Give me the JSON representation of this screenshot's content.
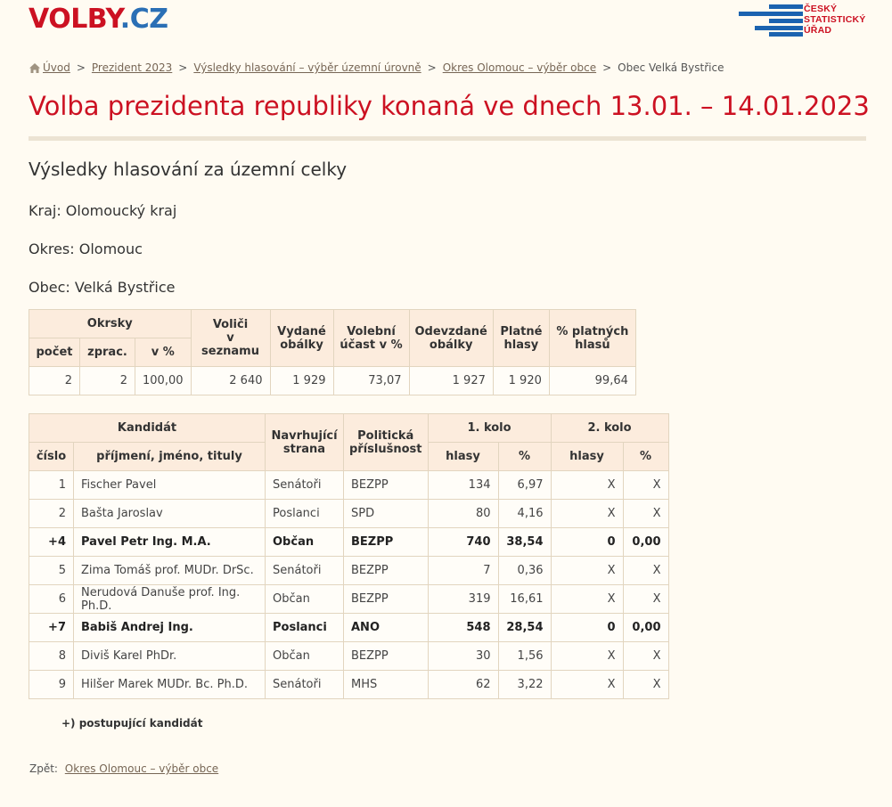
{
  "logo": {
    "part1": "VOLBY",
    "part2": ".CZ"
  },
  "csu_logo": {
    "line1": "ČESKÝ",
    "line2": "STATISTICKÝ",
    "line3": "ÚŘAD",
    "color": "#cc1122",
    "bar_color": "#1b63b0"
  },
  "breadcrumb": {
    "home": "Úvod",
    "items": [
      "Prezident 2023",
      "Výsledky hlasování – výběr územní úrovně",
      "Okres Olomouc – výběr obce"
    ],
    "current": "Obec Velká Bystřice",
    "separator": ">"
  },
  "title": "Volba prezidenta republiky konaná ve dnech 13.01. – 14.01.2023",
  "subtitle": "Výsledky hlasování za územní celky",
  "kraj": "Kraj: Olomoucký kraj",
  "okres": "Okres: Olomouc",
  "obec": "Obec: Velká Bystřice",
  "summary": {
    "headers": {
      "okrsky": "Okrsky",
      "pocet": "počet",
      "zprac": "zprac.",
      "v_pct": "v %",
      "volici1": "Voliči",
      "volici2": "v seznamu",
      "vydane1": "Vydané",
      "vydane2": "obálky",
      "ucast1": "Volební",
      "ucast2": "účast v %",
      "odevz1": "Odevzdané",
      "odevz2": "obálky",
      "platne1": "Platné",
      "platne2": "hlasy",
      "pctpl1": "% platných",
      "pctpl2": "hlasů"
    },
    "values": [
      "2",
      "2",
      "100,00",
      "2 640",
      "1 929",
      "73,07",
      "1 927",
      "1 920",
      "99,64"
    ]
  },
  "results": {
    "headers": {
      "kandidat": "Kandidát",
      "strana1": "Navrhující",
      "strana2": "strana",
      "prisl1": "Politická",
      "prisl2": "příslušnost",
      "kolo1": "1. kolo",
      "kolo2": "2. kolo",
      "cislo": "číslo",
      "jmeno": "příjmení, jméno, tituly",
      "hlasy1": "hlasy",
      "pct1": "%",
      "hlasy2": "hlasy",
      "pct2": "%"
    },
    "rows": [
      [
        "1",
        "Fischer Pavel",
        "Senátoři",
        "BEZPP",
        "134",
        "6,97",
        "X",
        "X"
      ],
      [
        "2",
        "Bašta Jaroslav",
        "Poslanci",
        "SPD",
        "80",
        "4,16",
        "X",
        "X"
      ],
      [
        "+4",
        "Pavel Petr Ing. M.A.",
        "Občan",
        "BEZPP",
        "740",
        "38,54",
        "0",
        "0,00"
      ],
      [
        "5",
        "Zima Tomáš prof. MUDr. DrSc.",
        "Senátoři",
        "BEZPP",
        "7",
        "0,36",
        "X",
        "X"
      ],
      [
        "6",
        "Nerudová Danuše prof. Ing. Ph.D.",
        "Občan",
        "BEZPP",
        "319",
        "16,61",
        "X",
        "X"
      ],
      [
        "+7",
        "Babiš Andrej Ing.",
        "Poslanci",
        "ANO",
        "548",
        "28,54",
        "0",
        "0,00"
      ],
      [
        "8",
        "Diviš Karel PhDr.",
        "Občan",
        "BEZPP",
        "30",
        "1,56",
        "X",
        "X"
      ],
      [
        "9",
        "Hilšer Marek MUDr. Bc. Ph.D.",
        "Senátoři",
        "MHS",
        "62",
        "3,22",
        "X",
        "X"
      ]
    ]
  },
  "note": "+) postupující kandidát",
  "back": {
    "label": "Zpět:",
    "link": "Okres Olomouc – výběr obce"
  }
}
